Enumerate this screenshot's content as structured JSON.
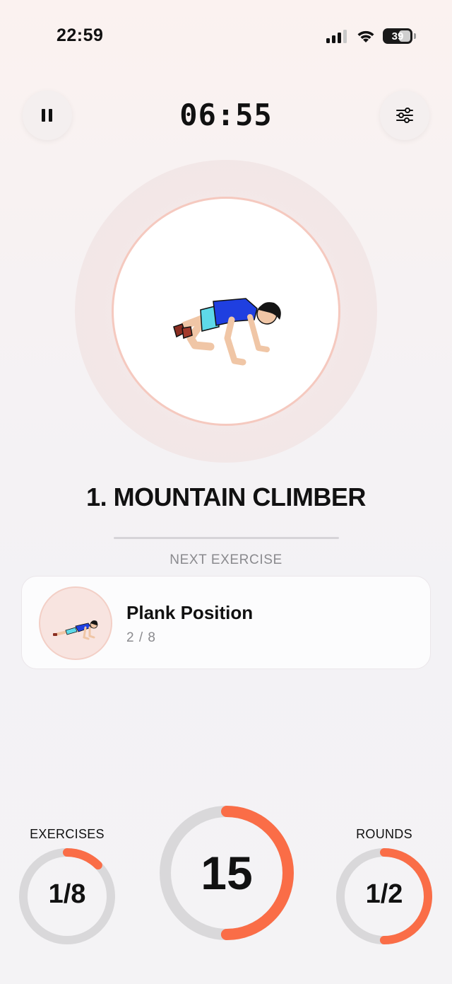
{
  "status_bar": {
    "time": "22:59",
    "battery_level": "39"
  },
  "header": {
    "timer": "06:55",
    "pause_icon": "pause-icon",
    "settings_icon": "sliders-icon"
  },
  "current_exercise": {
    "title": "1. MOUNTAIN CLIMBER"
  },
  "next_exercise": {
    "section_label": "NEXT EXERCISE",
    "name": "Plank Position",
    "position": "2 / 8"
  },
  "stats": {
    "exercises": {
      "label": "EXERCISES",
      "value": "1/8",
      "progress": 0.125
    },
    "countdown": {
      "value": "15",
      "progress": 0.5
    },
    "rounds": {
      "label": "ROUNDS",
      "value": "1/2",
      "progress": 0.5
    }
  },
  "colors": {
    "accent": "#fa6d47",
    "ring_track": "#d9d8da"
  }
}
